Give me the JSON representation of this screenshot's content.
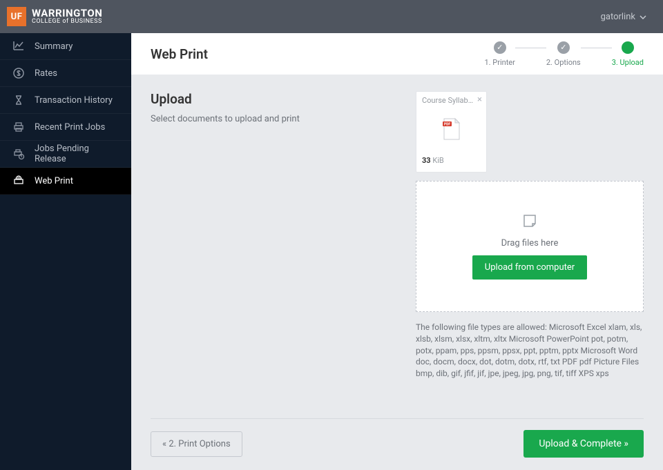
{
  "brand": {
    "badge": "UF",
    "title": "WARRINGTON",
    "subtitle": "COLLEGE of BUSINESS"
  },
  "user": {
    "name": "gatorlink"
  },
  "sidebar": {
    "items": [
      {
        "label": "Summary",
        "active": false
      },
      {
        "label": "Rates",
        "active": false
      },
      {
        "label": "Transaction History",
        "active": false
      },
      {
        "label": "Recent Print Jobs",
        "active": false
      },
      {
        "label": "Jobs Pending Release",
        "active": false
      },
      {
        "label": "Web Print",
        "active": true
      }
    ]
  },
  "page": {
    "title": "Web Print",
    "steps": [
      {
        "label": "1. Printer",
        "state": "done"
      },
      {
        "label": "2. Options",
        "state": "done"
      },
      {
        "label": "3. Upload",
        "state": "current"
      }
    ]
  },
  "upload": {
    "heading": "Upload",
    "description": "Select documents to upload and print",
    "files": [
      {
        "name": "Course Syllabus…",
        "size": "33",
        "unit": "KiB",
        "type": "pdf"
      }
    ],
    "drag_text": "Drag files here",
    "upload_btn": "Upload from computer",
    "allowed_types": "The following file types are allowed: Microsoft Excel xlam, xls, xlsb, xlsm, xlsx, xltm, xltx Microsoft PowerPoint pot, potm, potx, ppam, pps, ppsm, ppsx, ppt, pptm, pptx Microsoft Word doc, docm, docx, dot, dotm, dotx, rtf, txt PDF pdf Picture Files bmp, dib, gif, jfif, jif, jpe, jpeg, jpg, png, tif, tiff XPS xps"
  },
  "footer": {
    "back": "« 2. Print Options",
    "complete": "Upload & Complete »"
  }
}
